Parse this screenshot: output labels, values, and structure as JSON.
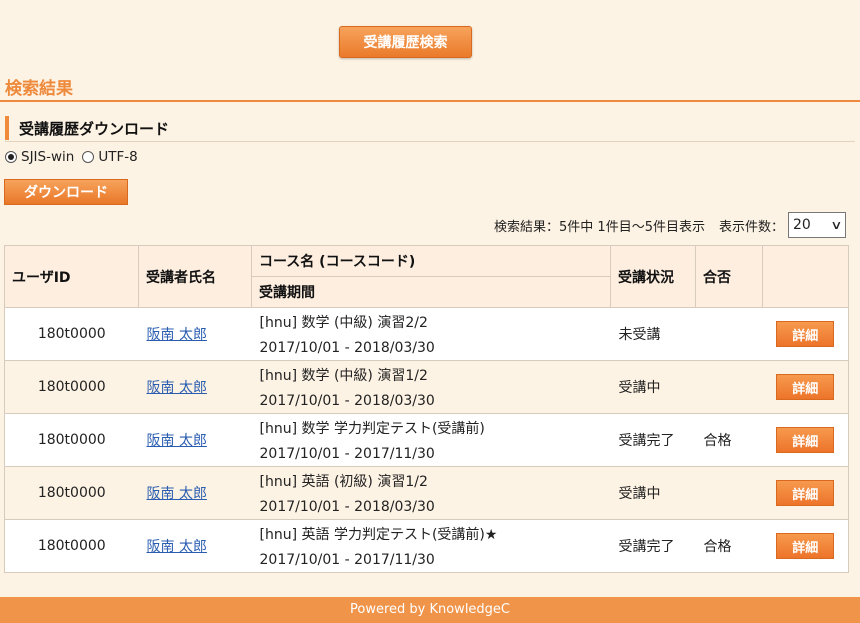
{
  "search_button": "受講履歴検索",
  "results_title": "検索結果",
  "download_section": {
    "title": "受講履歴ダウンロード",
    "options": [
      {
        "label": "SJIS-win",
        "selected": true
      },
      {
        "label": "UTF-8",
        "selected": false
      }
    ],
    "download_button": "ダウンロード"
  },
  "paging": {
    "summary": "検索結果：5件中 1件目〜5件目表示",
    "per_page_label": "表示件数：",
    "per_page_value": "20"
  },
  "table": {
    "headers": {
      "user_id": "ユーザID",
      "name": "受講者氏名",
      "course": "コース名 (コースコード)",
      "period": "受講期間",
      "status": "受講状況",
      "result": "合否"
    },
    "rows": [
      {
        "user_id": "180t0000",
        "name": "阪南 太郎",
        "course": "[hnu] 数学 (中級) 演習2/2",
        "period": "2017/10/01 - 2018/03/30",
        "status": "未受講",
        "result": "",
        "button": "詳細"
      },
      {
        "user_id": "180t0000",
        "name": "阪南 太郎",
        "course": "[hnu] 数学 (中級) 演習1/2",
        "period": "2017/10/01 - 2018/03/30",
        "status": "受講中",
        "result": "",
        "button": "詳細"
      },
      {
        "user_id": "180t0000",
        "name": "阪南 太郎",
        "course": "[hnu] 数学 学力判定テスト(受講前)",
        "period": "2017/10/01 - 2017/11/30",
        "status": "受講完了",
        "result": "合格",
        "button": "詳細"
      },
      {
        "user_id": "180t0000",
        "name": "阪南 太郎",
        "course": "[hnu] 英語 (初級) 演習1/2",
        "period": "2017/10/01 - 2018/03/30",
        "status": "受講中",
        "result": "",
        "button": "詳細"
      },
      {
        "user_id": "180t0000",
        "name": "阪南 太郎",
        "course": "[hnu] 英語 学力判定テスト(受講前)★",
        "period": "2017/10/01 - 2017/11/30",
        "status": "受講完了",
        "result": "合格",
        "button": "詳細"
      }
    ]
  },
  "footer": "Powered by KnowledgeC",
  "colors": {
    "accent": "#ef8a3c",
    "background": "#fdf3e4",
    "footer": "#f0944a"
  }
}
